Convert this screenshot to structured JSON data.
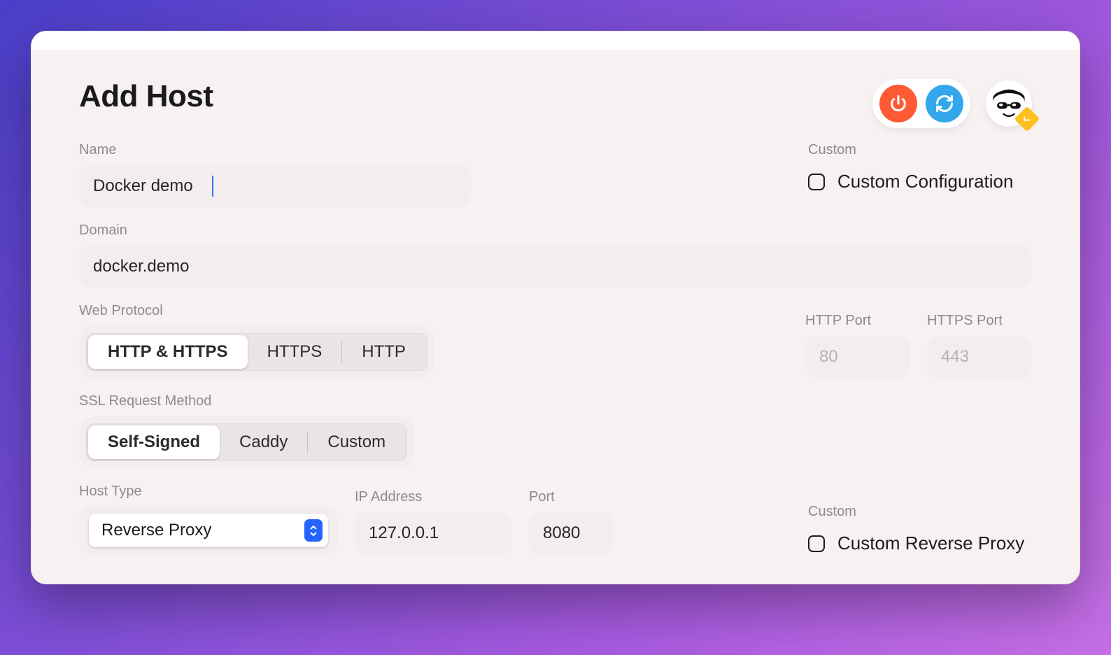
{
  "header": {
    "title": "Add Host"
  },
  "fields": {
    "name_label": "Name",
    "name_value": "Docker demo",
    "domain_label": "Domain",
    "domain_value": "docker.demo",
    "web_protocol_label": "Web Protocol",
    "protocol_options": {
      "both": "HTTP & HTTPS",
      "https": "HTTPS",
      "http": "HTTP"
    },
    "http_port_label": "HTTP Port",
    "http_port_value": "80",
    "https_port_label": "HTTPS Port",
    "https_port_value": "443",
    "ssl_label": "SSL Request Method",
    "ssl_options": {
      "self": "Self-Signed",
      "caddy": "Caddy",
      "custom": "Custom"
    },
    "host_type_label": "Host Type",
    "host_type_value": "Reverse Proxy",
    "ip_label": "IP Address",
    "ip_value": "127.0.0.1",
    "port_label": "Port",
    "port_value": "8080"
  },
  "custom": {
    "top_label": "Custom",
    "config_label": "Custom Configuration",
    "bottom_label": "Custom",
    "reverse_proxy_label": "Custom Reverse Proxy"
  }
}
